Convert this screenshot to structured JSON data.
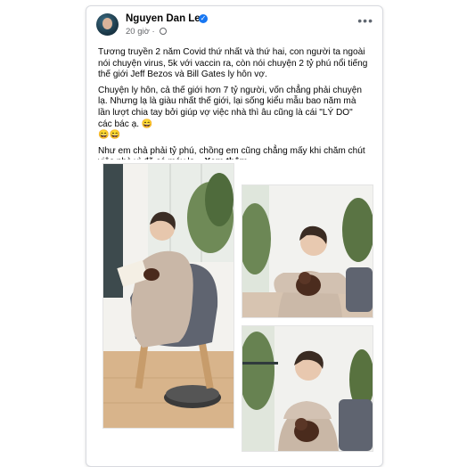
{
  "post": {
    "author": "Nguyen Dan Le",
    "time": "20 giờ",
    "more_icon": "ellipsis-icon",
    "paragraphs": [
      "Tương truyền 2 năm Covid thứ nhất và thứ hai, con người ta ngoài nói chuyện virus, 5k với vaccin ra, còn nói chuyện 2 tỷ phú nổi tiếng thế giới Jeff Bezos và Bill Gates ly hôn vợ.",
      "Chuyện ly hôn, cả thế giới hơn 7 tỷ người, vốn chẳng phải chuyện lạ. Nhưng lạ là giàu nhất thế giới, lại sống kiểu mẫu bao năm mà lần lượt chia tay bởi giúp vợ việc nhà thì âu cũng là cái \"LÝ DO\" các bác ạ.",
      "Như em chả phải tỷ phú, chồng em cũng chẳng mấy khi chăm chút việc nhà vì đã có máy lo..."
    ],
    "emoji_line": "😄😄",
    "emoji_inline": "😄",
    "see_more": "Xem thêm"
  },
  "colors": {
    "brand_blue": "#1877f2",
    "text": "#050505",
    "meta": "#65676b"
  }
}
